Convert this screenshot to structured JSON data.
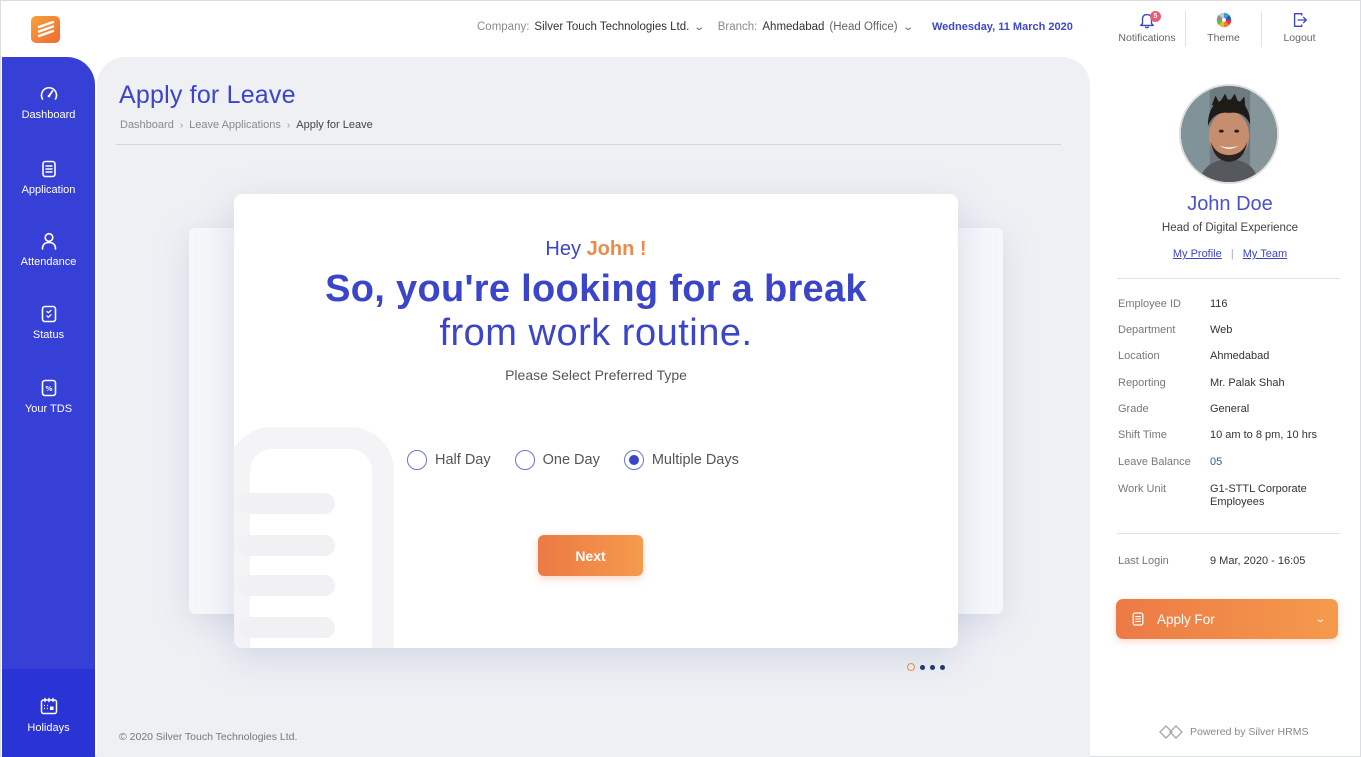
{
  "header": {
    "company_label": "Company:",
    "company_value": "Silver Touch Technologies Ltd.",
    "branch_label": "Branch:",
    "branch_value": "Ahmedabad",
    "branch_sub": "(Head Office)",
    "date": "Wednesday, 11 March 2020",
    "actions": [
      {
        "label": "Notifications",
        "icon": "bell-icon",
        "badge": "5"
      },
      {
        "label": "Theme",
        "icon": "color-wheel-icon"
      },
      {
        "label": "Logout",
        "icon": "logout-icon"
      }
    ]
  },
  "sidebar": {
    "items": [
      {
        "label": "Dashboard",
        "icon": "speedometer-icon"
      },
      {
        "label": "Application",
        "icon": "document-icon"
      },
      {
        "label": "Attendance",
        "icon": "person-icon"
      },
      {
        "label": "Status",
        "icon": "checklist-icon"
      },
      {
        "label": "Your TDS",
        "icon": "percent-icon"
      }
    ],
    "bottom_item": {
      "label": "Holidays",
      "icon": "calendar-icon"
    }
  },
  "main": {
    "title": "Apply for Leave",
    "breadcrumb": [
      "Dashboard",
      "Leave Applications",
      "Apply for Leave"
    ],
    "card": {
      "greeting": "Hey",
      "greeting_name": "John !",
      "headline": "So, you're looking for a break",
      "subline": "from work routine.",
      "prompt": "Please Select Preferred Type",
      "options": [
        {
          "label": "Half Day",
          "selected": false
        },
        {
          "label": "One Day",
          "selected": false
        },
        {
          "label": "Multiple Days",
          "selected": true
        }
      ],
      "next_label": "Next"
    },
    "pager": {
      "total": 4,
      "current": 1
    },
    "copyright": "© 2020 Silver Touch Technologies Ltd."
  },
  "profile": {
    "name": "John Doe",
    "role": "Head of Digital Experience",
    "links": [
      "My Profile",
      "My Team"
    ],
    "details": [
      {
        "label": "Employee ID",
        "value": "116"
      },
      {
        "label": "Department",
        "value": "Web"
      },
      {
        "label": "Location",
        "value": "Ahmedabad"
      },
      {
        "label": "Reporting",
        "value": "Mr. Palak Shah"
      },
      {
        "label": "Grade",
        "value": "General"
      },
      {
        "label": "Shift Time",
        "value": "10 am to 8 pm, 10 hrs"
      },
      {
        "label": "Leave Balance",
        "value": "05"
      },
      {
        "label": "Work Unit",
        "value": "G1-STTL Corporate Employees"
      }
    ],
    "last_login_label": "Last Login",
    "last_login_value": "9 Mar, 2020 - 16:05",
    "apply_for_label": "Apply For",
    "powered_by": "Powered by Silver HRMS"
  },
  "colors": {
    "primary": "#3640d6",
    "accent": "#ec7a45",
    "background": "#eef0f4"
  }
}
